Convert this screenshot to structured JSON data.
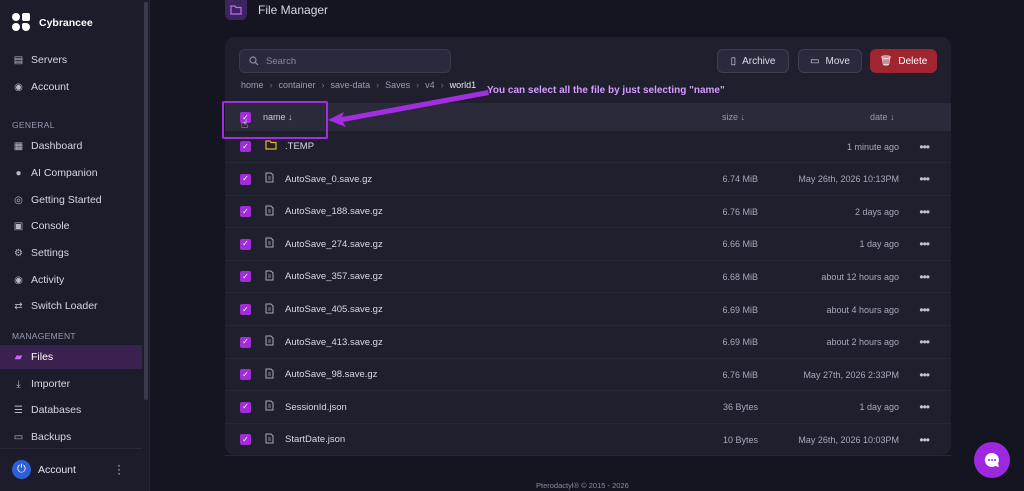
{
  "brand": {
    "name": "Cybrancee"
  },
  "sidebar": {
    "top_items": [
      {
        "label": "Servers",
        "icon": "server-icon"
      },
      {
        "label": "Account",
        "icon": "user-icon"
      }
    ],
    "general_label": "GENERAL",
    "general_items": [
      {
        "label": "Dashboard",
        "icon": "grid-icon"
      },
      {
        "label": "AI Companion",
        "icon": "chat-icon"
      },
      {
        "label": "Getting Started",
        "icon": "compass-icon"
      },
      {
        "label": "Console",
        "icon": "terminal-icon"
      },
      {
        "label": "Settings",
        "icon": "gear-icon"
      },
      {
        "label": "Activity",
        "icon": "eye-icon"
      },
      {
        "label": "Switch Loader",
        "icon": "swap-icon"
      }
    ],
    "management_label": "MANAGEMENT",
    "management_items": [
      {
        "label": "Files",
        "icon": "folder-icon",
        "active": true
      },
      {
        "label": "Importer",
        "icon": "download-icon"
      },
      {
        "label": "Databases",
        "icon": "database-icon"
      },
      {
        "label": "Backups",
        "icon": "archive-icon"
      }
    ],
    "account_label": "Account"
  },
  "header": {
    "title": "File Manager"
  },
  "toolbar": {
    "search_placeholder": "Search",
    "archive_label": "Archive",
    "move_label": "Move",
    "delete_label": "Delete"
  },
  "breadcrumb": [
    "home",
    "container",
    "save-data",
    "Saves",
    "v4",
    "world1"
  ],
  "table": {
    "col_name": "name ↓",
    "col_size": "size ↓",
    "col_date": "date ↓",
    "rows": [
      {
        "name": ".TEMP",
        "type": "folder",
        "size": "",
        "date": "1 minute ago"
      },
      {
        "name": "AutoSave_0.save.gz",
        "type": "file",
        "size": "6.74 MiB",
        "date": "May 26th, 2026 10:13PM"
      },
      {
        "name": "AutoSave_188.save.gz",
        "type": "file",
        "size": "6.76 MiB",
        "date": "2 days ago"
      },
      {
        "name": "AutoSave_274.save.gz",
        "type": "file",
        "size": "6.66 MiB",
        "date": "1 day ago"
      },
      {
        "name": "AutoSave_357.save.gz",
        "type": "file",
        "size": "6.68 MiB",
        "date": "about 12 hours ago"
      },
      {
        "name": "AutoSave_405.save.gz",
        "type": "file",
        "size": "6.69 MiB",
        "date": "about 4 hours ago"
      },
      {
        "name": "AutoSave_413.save.gz",
        "type": "file",
        "size": "6.69 MiB",
        "date": "about 2 hours ago"
      },
      {
        "name": "AutoSave_98.save.gz",
        "type": "file",
        "size": "6.76 MiB",
        "date": "May 27th, 2026 2:33PM"
      },
      {
        "name": "SessionId.json",
        "type": "doc",
        "size": "36 Bytes",
        "date": "1 day ago"
      },
      {
        "name": "StartDate.json",
        "type": "doc",
        "size": "10 Bytes",
        "date": "May 26th, 2026 10:03PM"
      }
    ]
  },
  "annotation": {
    "text": "You can select all the file by just selecting \"name\""
  },
  "footer": {
    "text": "Pterodactyl® © 2015 - 2026"
  },
  "colors": {
    "accent": "#a02dd6",
    "danger": "#a02530",
    "background": "#151521"
  }
}
